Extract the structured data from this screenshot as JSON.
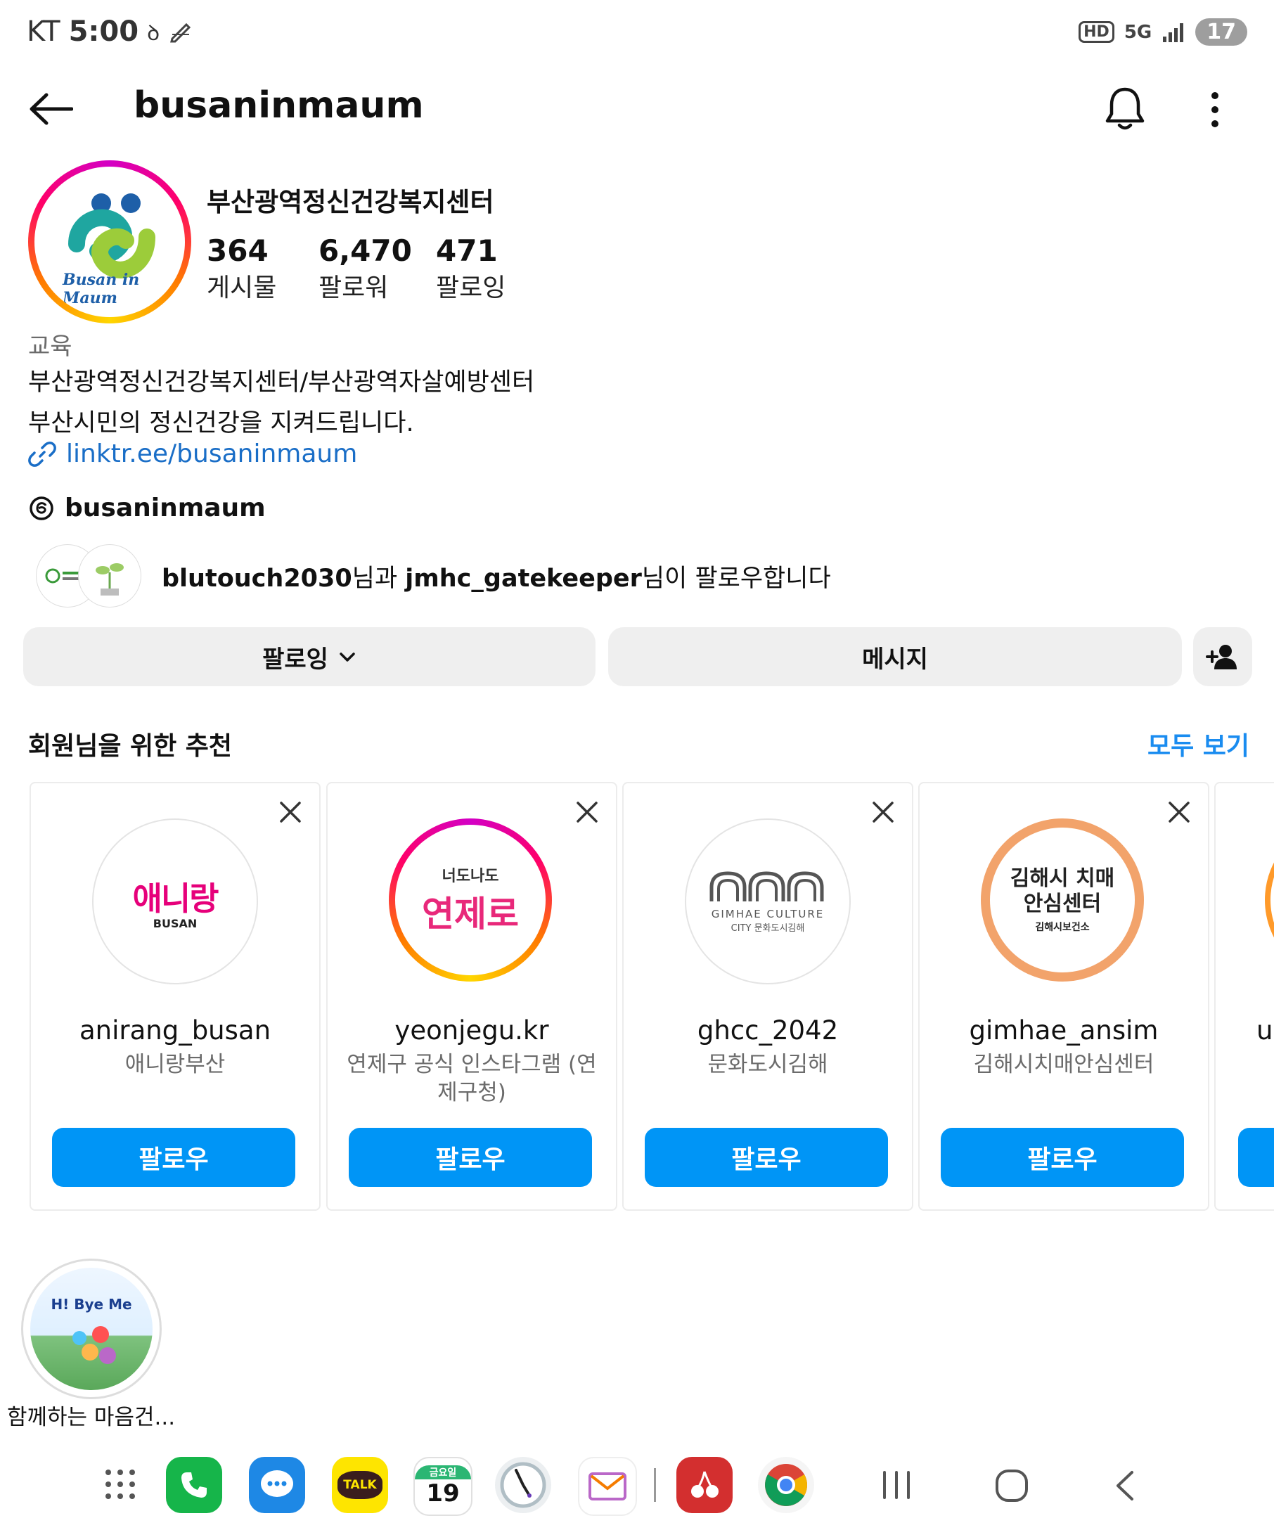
{
  "status_bar": {
    "carrier": "KT",
    "time": "5:00",
    "hd": "HD",
    "network": "5G",
    "battery": "17"
  },
  "header": {
    "username": "busaninmaum"
  },
  "profile": {
    "avatar_wordmark": "Busan in Maum",
    "display_name": "부산광역정신건강복지센터",
    "stats": [
      {
        "value": "364",
        "label": "게시물"
      },
      {
        "value": "6,470",
        "label": "팔로워"
      },
      {
        "value": "471",
        "label": "팔로잉"
      }
    ],
    "category": "교육",
    "bio_line1": "부산광역정신건강복지센터/부산광역자살예방센터",
    "bio_line2": "부산시민의 정신건강을 지켜드립니다.",
    "link": "linktr.ee/busaninmaum",
    "threads_handle": "busaninmaum",
    "followed_by": {
      "user1": "blutouch2030",
      "mid": "님과 ",
      "user2": "jmhc_gatekeeper",
      "tail": "님이 팔로우합니다"
    }
  },
  "actions": {
    "following_label": "팔로잉",
    "message_label": "메시지"
  },
  "suggestions": {
    "title": "회원님을 위한 추천",
    "see_all": "모두 보기",
    "follow_label": "팔로우",
    "cards": [
      {
        "handle": "anirang_busan",
        "name": "애니랑부산",
        "logo_text": "애니랑",
        "logo_sub": "BUSAN"
      },
      {
        "handle": "yeonjegu.kr",
        "name": "연제구 공식 인스타그램 (연제구청)",
        "logo_text": "연제로",
        "logo_sub": "너도나도"
      },
      {
        "handle": "ghcc_2042",
        "name": "문화도시김해",
        "logo_text": "GIMHAE CULTURE",
        "logo_sub": "CITY 문화도시김해"
      },
      {
        "handle": "gimhae_ansim",
        "name": "김해시치매안심센터",
        "logo_text": "김해시 치매안심센터",
        "logo_sub": "김해시보건소"
      }
    ],
    "partial_handle": "ul"
  },
  "highlight": {
    "label": "함께하는 마음건...",
    "title": "H! Bye Me"
  },
  "dock": {
    "calendar_day": "금요일",
    "calendar_date": "19",
    "talk": "TALK"
  },
  "colors": {
    "accent_blue": "#0095f6",
    "link_blue": "#1a6ec7"
  }
}
